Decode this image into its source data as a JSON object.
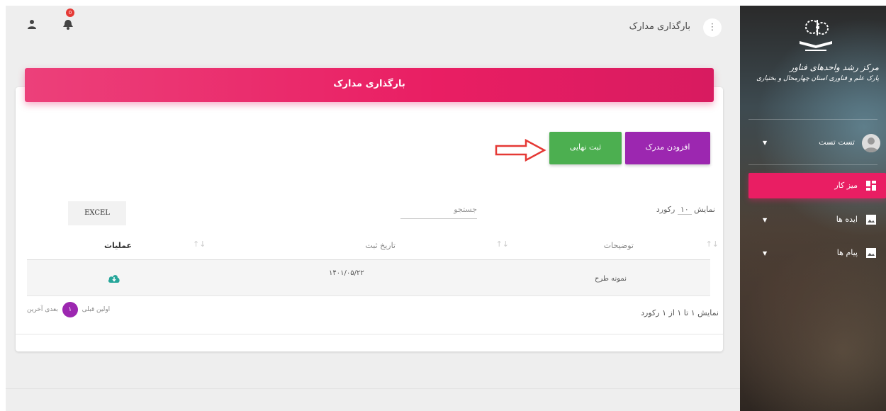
{
  "header": {
    "page_title": "بارگذاری مدارک",
    "menu_glyph": "⋮",
    "notification_count": "0"
  },
  "card": {
    "title": "بارگذاری مدارک",
    "add_button": "افزودن مدرک",
    "final_button": "ثبت نهایی",
    "excel_button": "EXCEL",
    "show_prefix": "نمایش",
    "show_count": "۱۰",
    "show_suffix": "رکورد",
    "search_placeholder": "جستجو"
  },
  "table": {
    "columns": [
      "توضیحات",
      "تاریخ ثبت",
      "عملیات"
    ],
    "rows": [
      {
        "description": "نمونه طرح",
        "date": "۱۴۰۱/۰۵/۲۲"
      }
    ],
    "info": "نمایش ۱ تا ۱ از ۱ رکورد"
  },
  "pagination": {
    "first": "اولین",
    "prev": "قبلی",
    "current": "۱",
    "next": "بعدی",
    "last": "آخرین"
  },
  "sidebar": {
    "org_line1": "مرکز رشد واحدهای فناور",
    "org_line2": "پارک علم و فناوری استان چهارمحال و بختیاری",
    "user_name": "تست تست",
    "items": [
      {
        "label": "میز کار",
        "active": true
      },
      {
        "label": "ایده ها",
        "active": false
      },
      {
        "label": "پیام ها",
        "active": false
      }
    ]
  },
  "colors": {
    "accent_pink": "#e91e63",
    "purple": "#9c27b0",
    "green": "#4caf50",
    "annotation_red": "#e53935"
  },
  "icons": [
    "menu-icon",
    "user-icon",
    "bell-icon",
    "cloud-download-icon",
    "dashboard-icon",
    "image-icon",
    "sort-icon",
    "arrow-annotation-icon"
  ]
}
